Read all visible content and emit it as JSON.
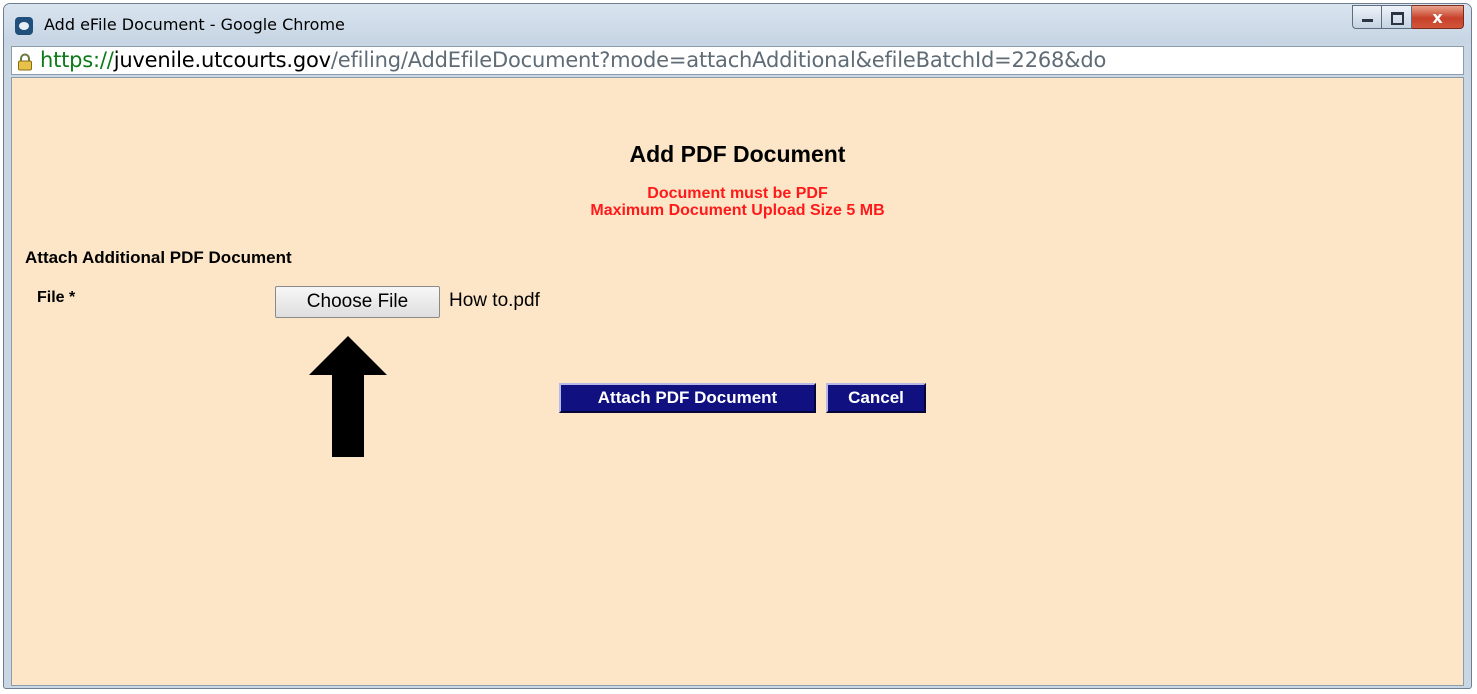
{
  "window": {
    "title": "Add eFile Document - Google Chrome",
    "close_glyph": "x"
  },
  "address_bar": {
    "scheme": "https://",
    "host": "juvenile.utcourts.gov",
    "path": "/efiling/AddEfileDocument?mode=attachAdditional&efileBatchId=2268&do"
  },
  "page": {
    "title": "Add PDF Document",
    "notice_line1": "Document must be PDF",
    "notice_line2": "Maximum Document Upload Size 5 MB",
    "section_label": "Attach Additional PDF Document",
    "file_label": "File *",
    "choose_file_label": "Choose File",
    "selected_file": "How to.pdf",
    "attach_button_label": "Attach PDF Document",
    "cancel_button_label": "Cancel"
  },
  "colors": {
    "content_background": "#fde6c8",
    "notice_text": "#ff1a1a",
    "action_button_bg": "#101080",
    "url_scheme": "#0b7a17"
  },
  "icons": {
    "window_icon": "chrome-app-icon",
    "lock": "lock-icon",
    "annotation": "up-arrow-icon"
  }
}
